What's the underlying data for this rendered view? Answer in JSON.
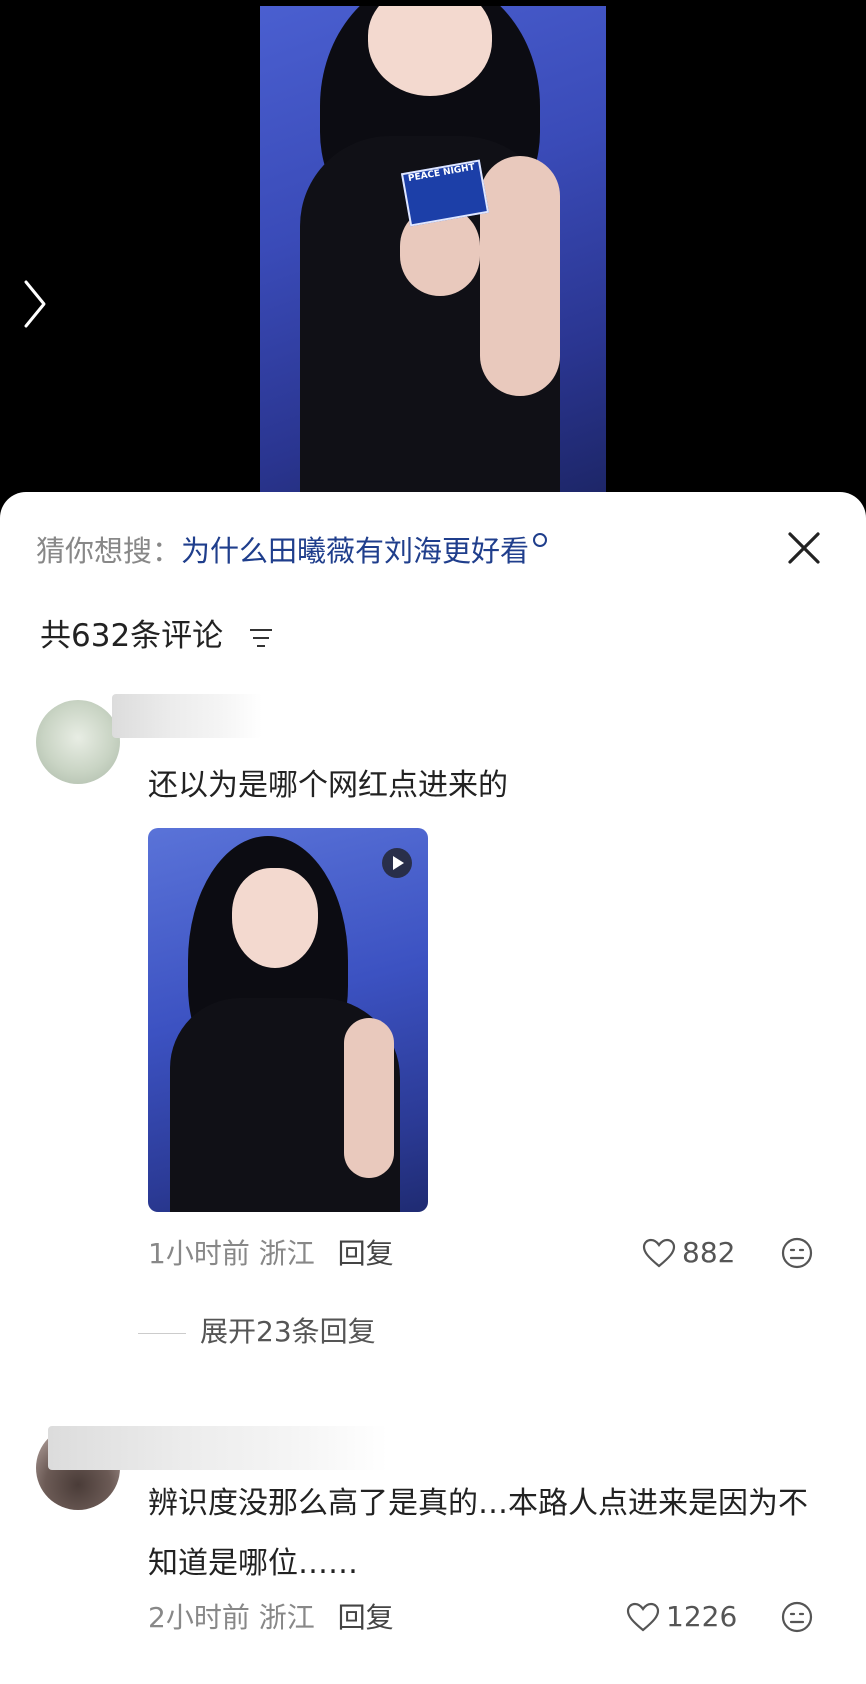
{
  "video": {
    "mic_text": "PEACE NIGHT"
  },
  "search_suggest": {
    "prefix": "猜你想搜：",
    "query": "为什么田曦薇有刘海更好看"
  },
  "comments_header": {
    "count_label": "共632条评论"
  },
  "comments": [
    {
      "text": "还以为是哪个网红点进来的",
      "time": "1小时前",
      "location": "浙江",
      "reply_label": "回复",
      "likes": "882",
      "expand_label": "展开23条回复"
    },
    {
      "text": "辨识度没那么高了是真的…本路人点进来是因为不知道是哪位……",
      "time": "2小时前",
      "location": "浙江",
      "reply_label": "回复",
      "likes": "1226"
    }
  ],
  "colors": {
    "query_blue": "#1f3e8c",
    "meta_gray": "#888888",
    "stage_blue": "#3a4bb8"
  }
}
